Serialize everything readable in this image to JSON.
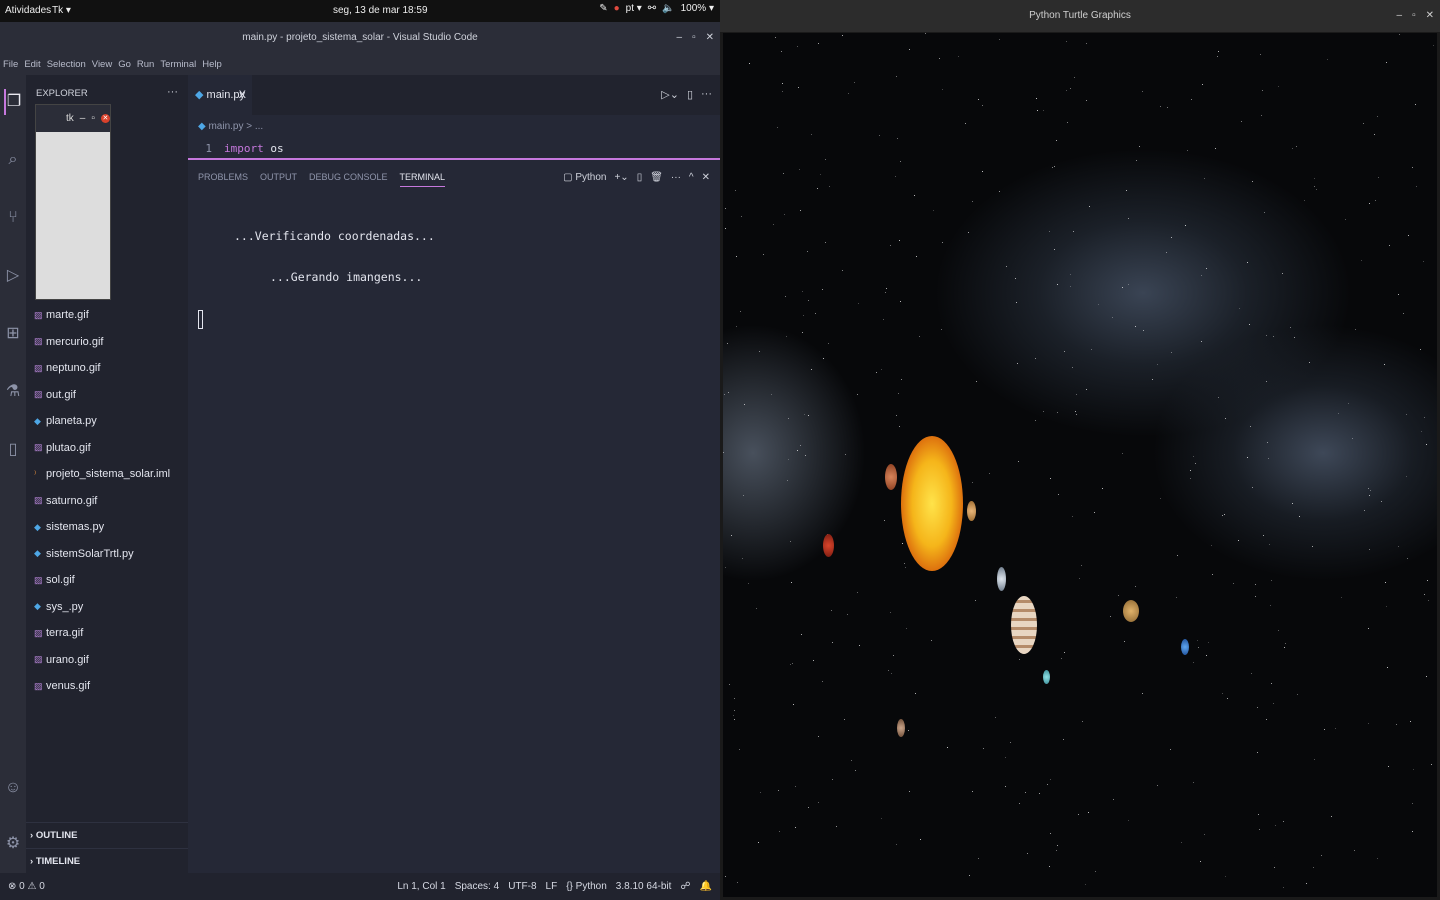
{
  "topbar": {
    "activities": "Atividades",
    "app_menu": "Tk ▾",
    "clock": "seg, 13 de mar 18:59",
    "lang": "pt ▾",
    "battery": "100% ▾"
  },
  "vscode": {
    "title": "main.py - projeto_sistema_solar - Visual Studio Code",
    "menu": [
      "File",
      "Edit",
      "Selection",
      "View",
      "Go",
      "Run",
      "Terminal",
      "Help"
    ],
    "explorer_title": "EXPLORER",
    "files": [
      {
        "name": "marte.gif",
        "type": "gif"
      },
      {
        "name": "mercurio.gif",
        "type": "gif"
      },
      {
        "name": "neptuno.gif",
        "type": "gif"
      },
      {
        "name": "out.gif",
        "type": "gif"
      },
      {
        "name": "planeta.py",
        "type": "py"
      },
      {
        "name": "plutao.gif",
        "type": "gif"
      },
      {
        "name": "projeto_sistema_solar.iml",
        "type": "xml"
      },
      {
        "name": "saturno.gif",
        "type": "gif"
      },
      {
        "name": "sistemas.py",
        "type": "py"
      },
      {
        "name": "sistemSolarTrtl.py",
        "type": "py"
      },
      {
        "name": "sol.gif",
        "type": "gif"
      },
      {
        "name": "sys_.py",
        "type": "py"
      },
      {
        "name": "terra.gif",
        "type": "gif"
      },
      {
        "name": "urano.gif",
        "type": "gif"
      },
      {
        "name": "venus.gif",
        "type": "gif"
      }
    ],
    "outline": "OUTLINE",
    "timeline": "TIMELINE",
    "tab": "main.py",
    "breadcrumb": "main.py > ...",
    "code_line_number": "1",
    "code_keyword": "import",
    "code_rest": " os",
    "panel_tabs": [
      "PROBLEMS",
      "OUTPUT",
      "DEBUG CONSOLE",
      "TERMINAL"
    ],
    "terminal_name": "Python",
    "terminal_lines": [
      "...Verificando coordenadas...",
      "...Gerando imangens..."
    ],
    "status_left": "⊗ 0 ⚠ 0",
    "status_right": [
      "Ln 1, Col 1",
      "Spaces: 4",
      "UTF-8",
      "LF",
      "{} Python",
      "3.8.10 64-bit"
    ]
  },
  "tk_window": {
    "title": "tk"
  },
  "turtle": {
    "title": "Python Turtle Graphics"
  }
}
